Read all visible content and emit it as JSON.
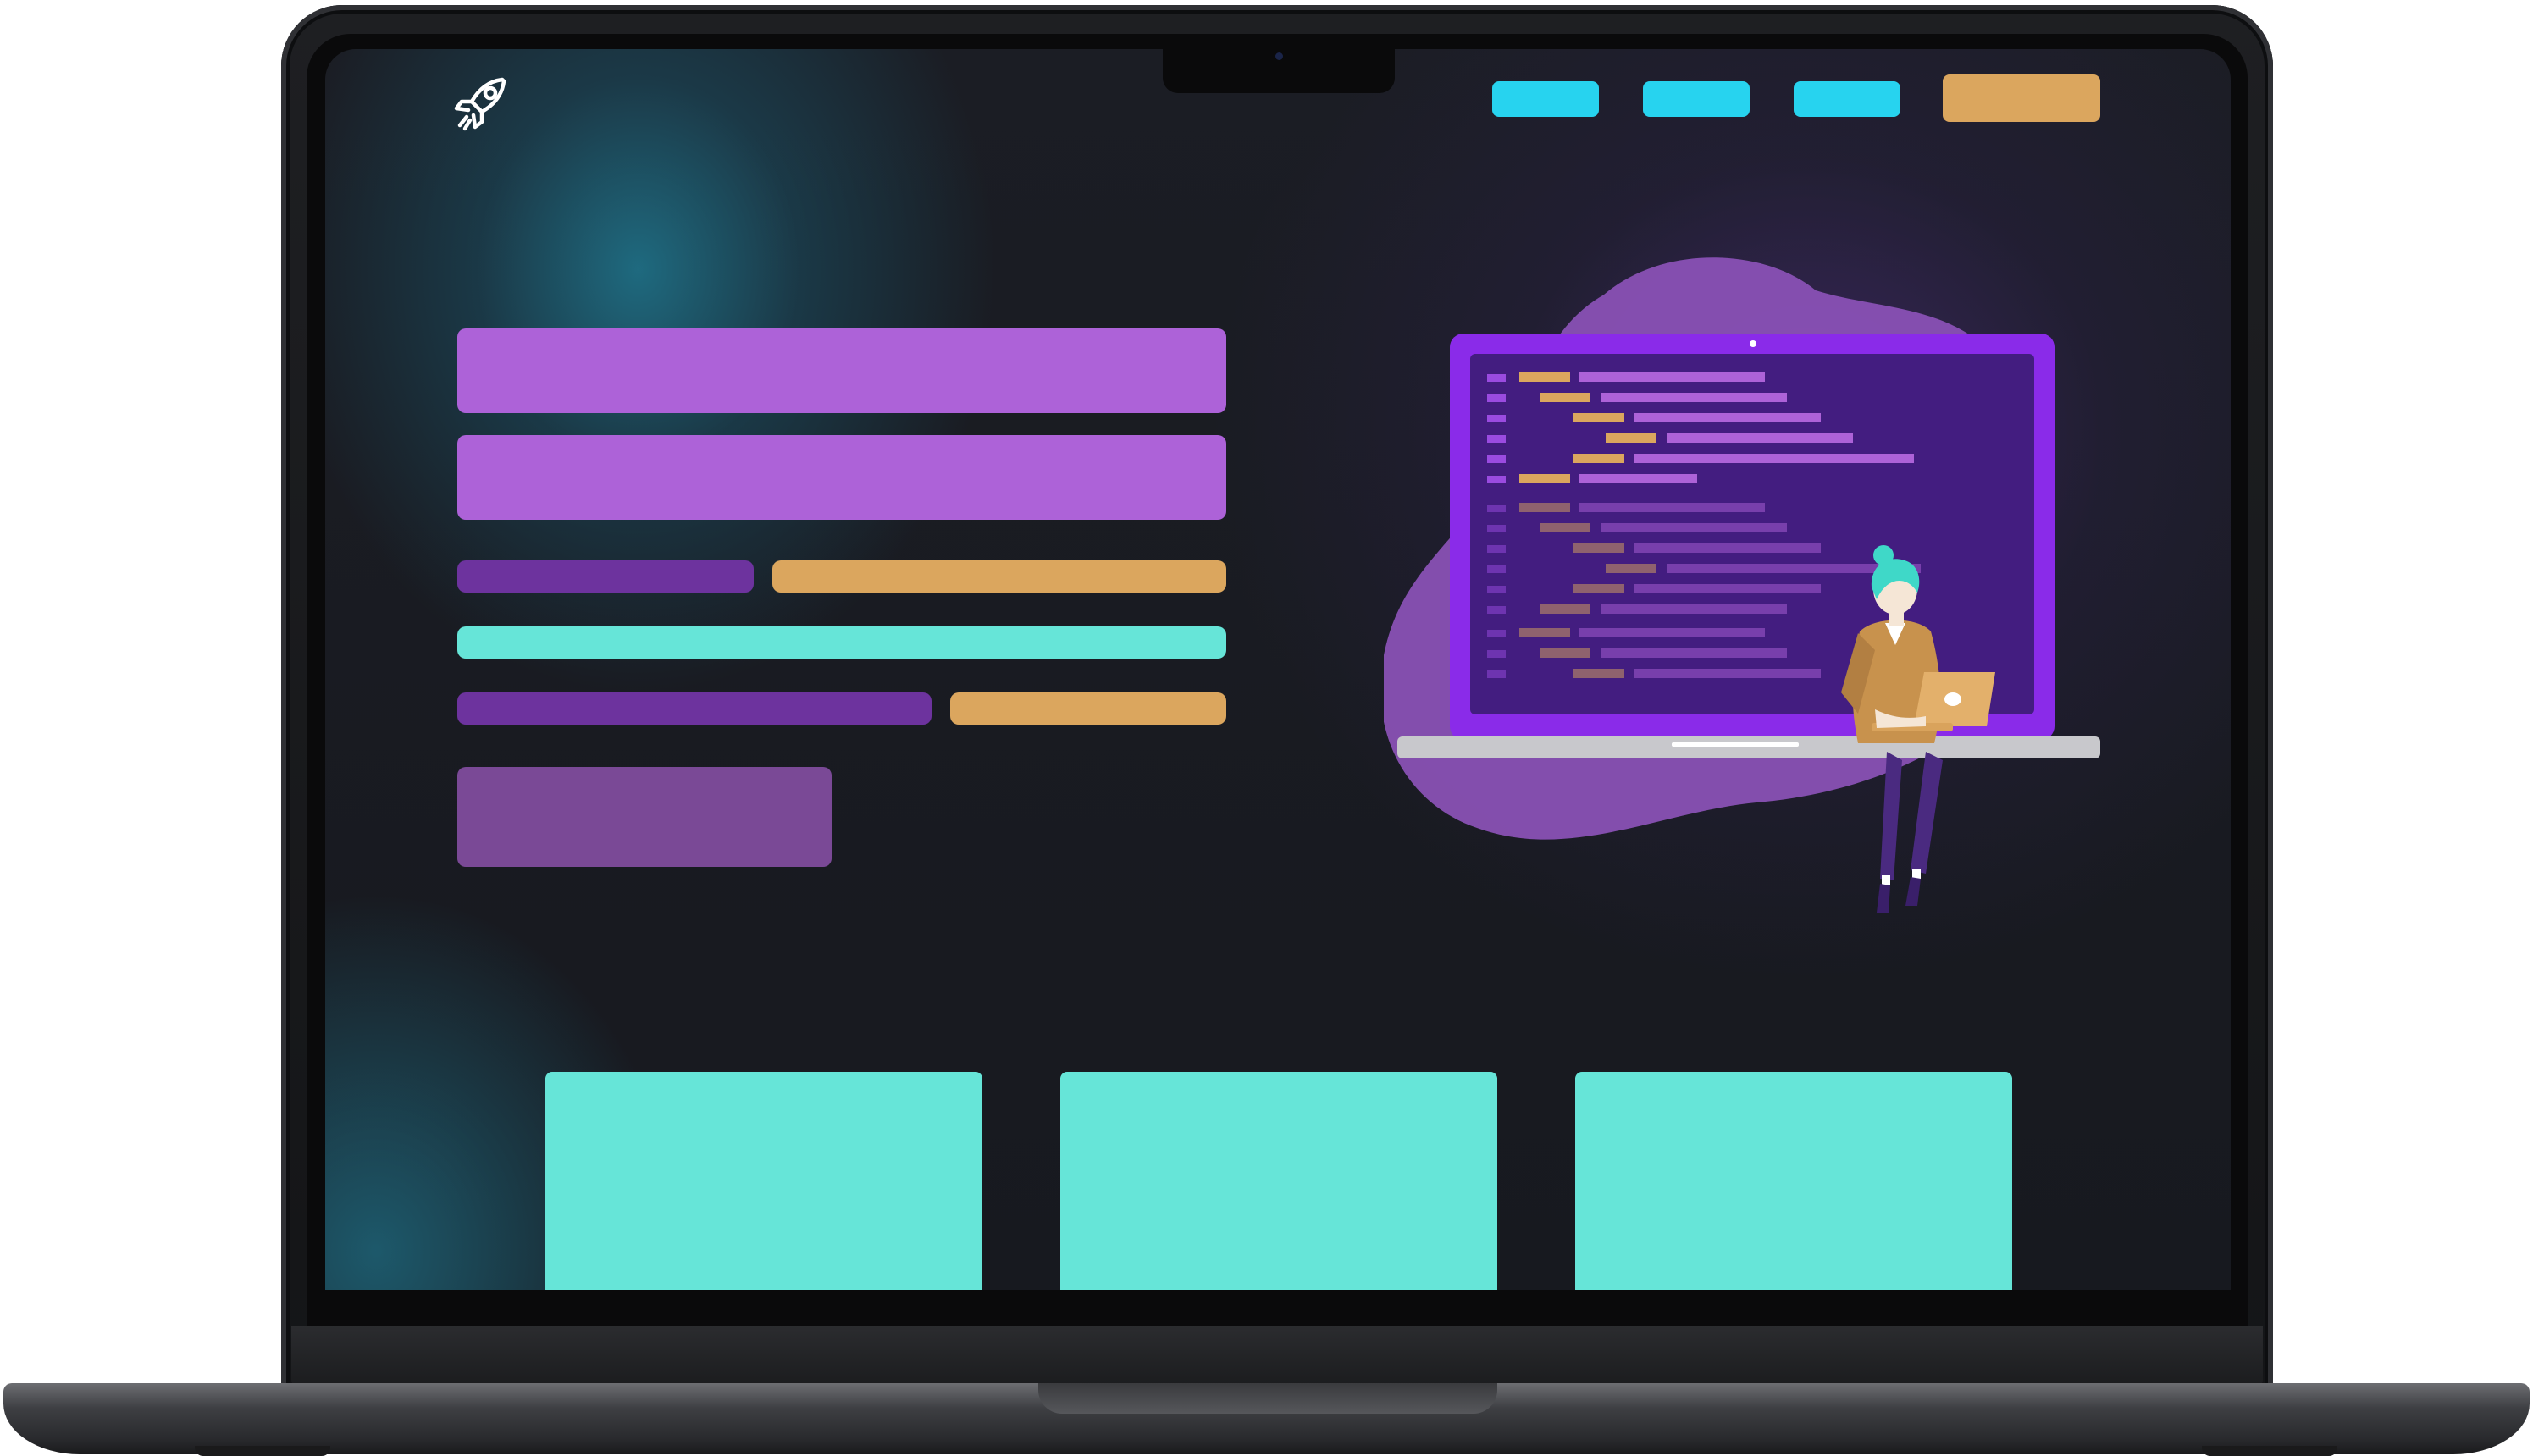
{
  "window": {
    "title": ""
  },
  "colors": {
    "nav_link": "#27d3ef",
    "nav_cta": "#dba65e",
    "heading_block": "#ad62d8",
    "dark_purple": "#6d339e",
    "orange": "#dba65e",
    "teal": "#66e5d8",
    "button_block": "#7a4996",
    "blob": "#8c52b8",
    "screen_frame": "#8a2be9",
    "code_bg": "#431d80"
  },
  "icons": {
    "logo": "rocket-icon"
  },
  "nav": {
    "links": [
      "",
      "",
      ""
    ],
    "cta": ""
  },
  "hero": {
    "title_lines": [
      "",
      ""
    ],
    "text_lines": [
      "",
      "",
      "",
      "",
      ""
    ],
    "button": ""
  },
  "cards": [
    "",
    "",
    ""
  ]
}
